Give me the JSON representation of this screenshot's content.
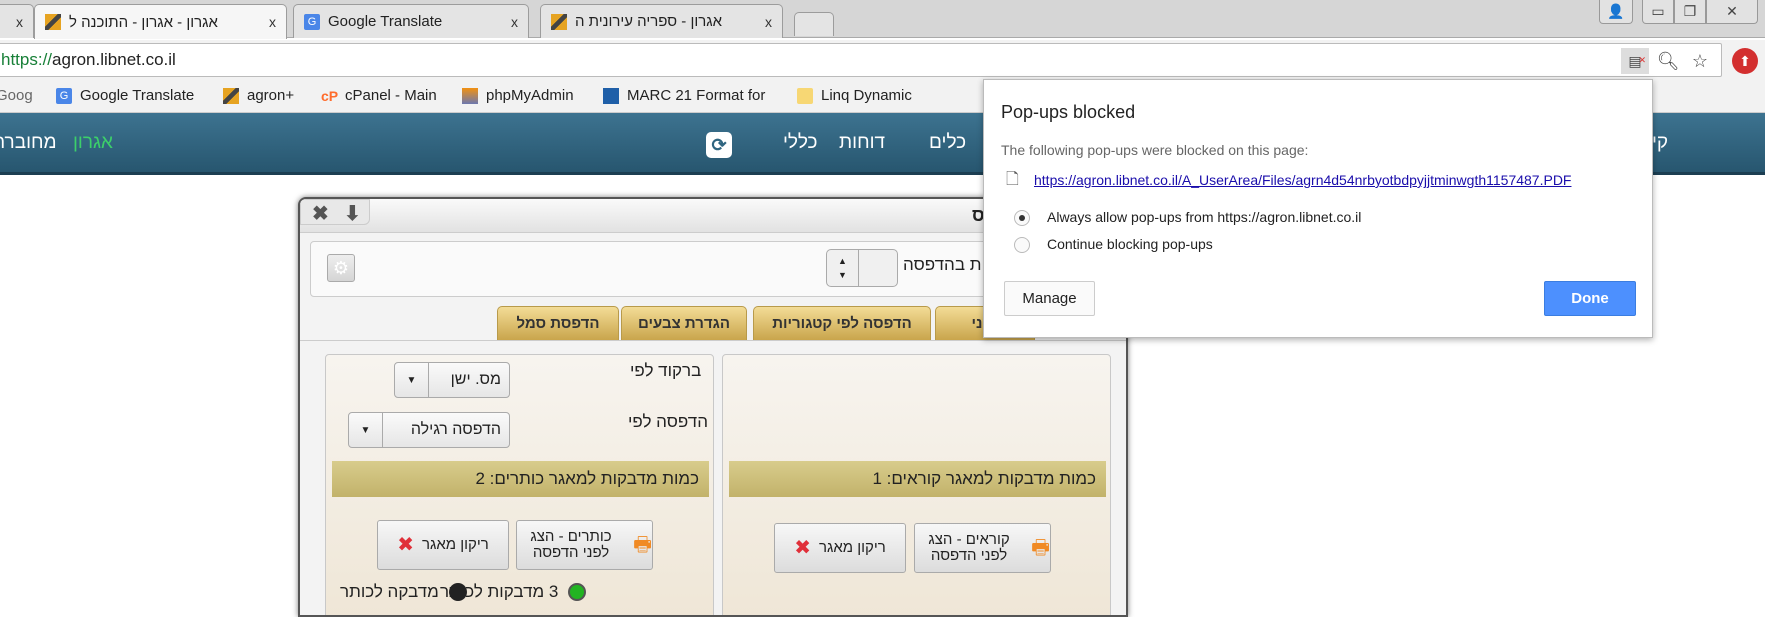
{
  "browser": {
    "tabs": [
      {
        "title": "",
        "close": "x"
      },
      {
        "title": "אגרון - אגרון - התוכנה ל",
        "close": "x",
        "active": true,
        "icon": "agron-icon"
      },
      {
        "title": "Google Translate",
        "close": "x",
        "icon": "google-translate-icon"
      },
      {
        "title": "אגרון - ספריה עירונית ה",
        "close": "x",
        "icon": "agron-icon"
      }
    ],
    "window_controls": {
      "user": "👤",
      "minimize": "▭",
      "restore": "❐",
      "close": "✕"
    },
    "address": {
      "scheme": "https://",
      "host": "agron.libnet.co.il"
    },
    "address_icons": [
      "popup-blocked-icon",
      "zoom-out-icon",
      "star-icon",
      "extension-icon"
    ],
    "bookmarks": [
      {
        "label": "Goog"
      },
      {
        "label": "Google Translate",
        "icon": "google-translate-icon"
      },
      {
        "label": "agron+",
        "icon": "agron-icon"
      },
      {
        "label": "cPanel - Main",
        "icon": "cpanel-icon"
      },
      {
        "label": "phpMyAdmin",
        "icon": "phpmyadmin-icon"
      },
      {
        "label": "MARC 21 Format for",
        "icon": "marc-icon"
      },
      {
        "label": "Linq Dynamic",
        "icon": "folder-icon"
      }
    ]
  },
  "site_nav": {
    "items": [
      "קי",
      "כלים",
      "דוחות",
      "כללי"
    ],
    "brand": "אגרון",
    "status": "מחוברת"
  },
  "dialog": {
    "title_partial": "ס",
    "copies_label": "ת בהדפסה",
    "copies_value": "",
    "tabs": [
      "זמני",
      "הדפסה לפי קטגוריות",
      "הגדרת צבעים",
      "הדפסת סמל"
    ],
    "left": {
      "barcode_label": "ברקוד לפי",
      "barcode_value": "מס. ישן",
      "print_label": "הדפסה לפי",
      "print_value": "הדפסה רגילה",
      "header": "כמות מדבקות למאגר כותרים: 2",
      "preview_button": "כותרים - הצג לפני הדפסה",
      "clear_button": "ריקון מאגר",
      "option_three": "3 מדבקות לכותר",
      "option_one": "מדבקה לכותר"
    },
    "right": {
      "header": "כמות מדבקות למאגר קוראים: 1",
      "preview_button": "קוראים - הצג לפני הדפסה",
      "clear_button": "ריקון מאגר"
    }
  },
  "popup": {
    "title": "Pop-ups blocked",
    "description": "The following pop-ups were blocked on this page:",
    "link": "https://agron.libnet.co.il/A_UserArea/Files/agrn4d54nrbyotbdpyjjtminwgth1157487.PDF",
    "options": [
      "Always allow pop-ups from https://agron.libnet.co.il",
      "Continue blocking pop-ups"
    ],
    "selected_option": 0,
    "manage": "Manage",
    "done": "Done"
  },
  "colors": {
    "nav": "#2f6580",
    "brand_green": "#3ccf6a",
    "done_blue": "#4d90fe",
    "gold": "#c9a54c",
    "link": "#1a0dab"
  }
}
